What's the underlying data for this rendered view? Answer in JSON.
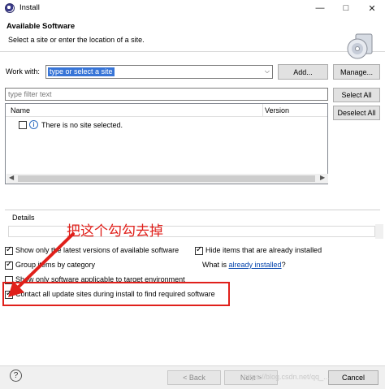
{
  "window": {
    "title": "Install",
    "minimize_icon": "minimize-icon",
    "maximize_icon": "maximize-icon",
    "close_icon": "close-icon"
  },
  "header": {
    "title": "Available Software",
    "subtitle": "Select a site or enter the location of a site."
  },
  "work_with": {
    "label": "Work with:",
    "value": "type or select a site",
    "add_button": "Add...",
    "manage_button": "Manage..."
  },
  "filter": {
    "placeholder": "type filter text",
    "select_all": "Select All",
    "deselect_all": "Deselect All"
  },
  "tree": {
    "columns": [
      "Name",
      "Version"
    ],
    "rows": [
      {
        "text": "There is no site selected.",
        "checked": false
      }
    ]
  },
  "details": {
    "label": "Details"
  },
  "options": {
    "latest_versions": {
      "label": "Show only the latest versions of available software",
      "checked": true
    },
    "hide_installed": {
      "label": "Hide items that are already installed",
      "checked": true
    },
    "group_by_category": {
      "label": "Group items by category",
      "checked": true
    },
    "what_is_prefix": "What is ",
    "already_installed_link": "already installed",
    "what_is_suffix": "?",
    "target_environment": {
      "label": "Show only software applicable to target environment",
      "checked": false
    },
    "contact_update_sites": {
      "label": "Contact all update sites during install to find required software",
      "checked": true
    }
  },
  "annotation": {
    "text": "把这个勾勾去掉",
    "color": "#e0201b"
  },
  "footer": {
    "back_button": "< Back",
    "next_button": "Next >",
    "cancel_button": "Cancel",
    "watermark": "https://blog.csdn.net/qq_..."
  },
  "colors": {
    "selection": "#3875d7",
    "link": "#0645ad",
    "highlight": "#e0201b"
  }
}
